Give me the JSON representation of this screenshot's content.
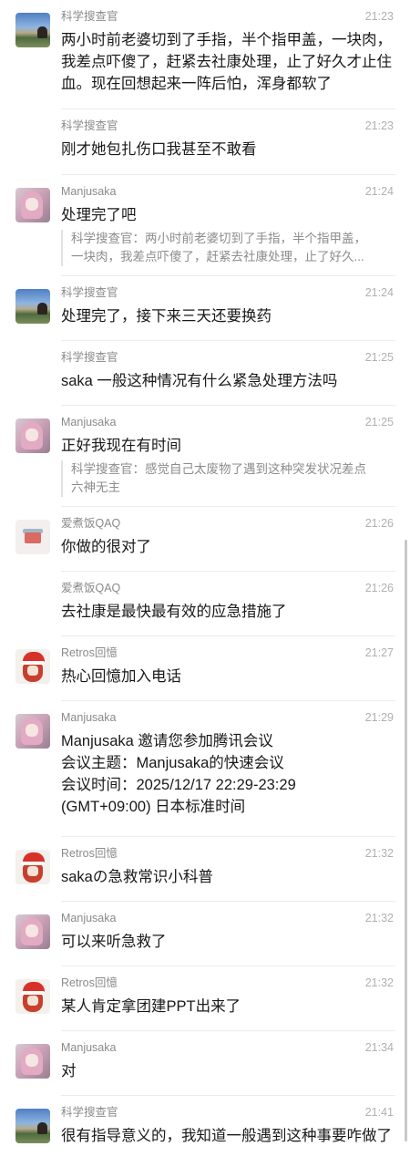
{
  "messages": [
    {
      "sender": "科学搜查官",
      "avatar": "kexue",
      "time": "21:23",
      "text": "两小时前老婆切到了手指，半个指甲盖，一块肉，\n我差点吓傻了，赶紧去社康处理，止了好久才止住\n血。现在回想起来一阵后怕，浑身都软了",
      "show_avatar": true
    },
    {
      "sender": "科学搜查官",
      "avatar": "kexue",
      "time": "21:23",
      "text": "刚才她包扎伤口我甚至不敢看",
      "show_avatar": false
    },
    {
      "sender": "Manjusaka",
      "avatar": "manju",
      "time": "21:24",
      "text": "处理完了吧",
      "quote": "科学搜查官：两小时前老婆切到了手指，半个指甲盖，\n一块肉，我差点吓傻了，赶紧去社康处理，止了好久...",
      "show_avatar": true
    },
    {
      "sender": "科学搜查官",
      "avatar": "kexue",
      "time": "21:24",
      "text": "处理完了，接下来三天还要换药",
      "show_avatar": true
    },
    {
      "sender": "科学搜查官",
      "avatar": "kexue",
      "time": "21:25",
      "text": "saka 一般这种情况有什么紧急处理方法吗",
      "show_avatar": false
    },
    {
      "sender": "Manjusaka",
      "avatar": "manju",
      "time": "21:25",
      "text": "正好我现在有时间",
      "quote": "科学搜查官：感觉自己太废物了遇到这种突发状况差点\n六神无主",
      "show_avatar": true
    },
    {
      "sender": "爱煮饭QAQ",
      "avatar": "aizhu",
      "time": "21:26",
      "text": "你做的很对了",
      "show_avatar": true
    },
    {
      "sender": "爱煮饭QAQ",
      "avatar": "aizhu",
      "time": "21:26",
      "text": "去社康是最快最有效的应急措施了",
      "show_avatar": false
    },
    {
      "sender": "Retros回憶",
      "avatar": "retros",
      "time": "21:27",
      "text": "热心回憶加入电话",
      "show_avatar": true
    },
    {
      "sender": "Manjusaka",
      "avatar": "manju",
      "time": "21:29",
      "text": "Manjusaka 邀请您参加腾讯会议\n会议主题：Manjusaka的快速会议\n会议时间：2025/12/17 22:29-23:29\n(GMT+09:00) 日本标准时间",
      "show_avatar": true
    },
    {
      "sender": "Retros回憶",
      "avatar": "retros",
      "time": "21:32",
      "text": "sakaの急救常识小科普",
      "show_avatar": true
    },
    {
      "sender": "Manjusaka",
      "avatar": "manju",
      "time": "21:32",
      "text": "可以来听急救了",
      "show_avatar": true
    },
    {
      "sender": "Retros回憶",
      "avatar": "retros",
      "time": "21:32",
      "text": "某人肯定拿团建PPT出来了",
      "show_avatar": true
    },
    {
      "sender": "Manjusaka",
      "avatar": "manju",
      "time": "21:34",
      "text": "对",
      "show_avatar": true
    },
    {
      "sender": "科学搜查官",
      "avatar": "kexue",
      "time": "21:41",
      "text": "很有指导意义的，我知道一般遇到这种事要咋做了",
      "show_avatar": true
    }
  ]
}
